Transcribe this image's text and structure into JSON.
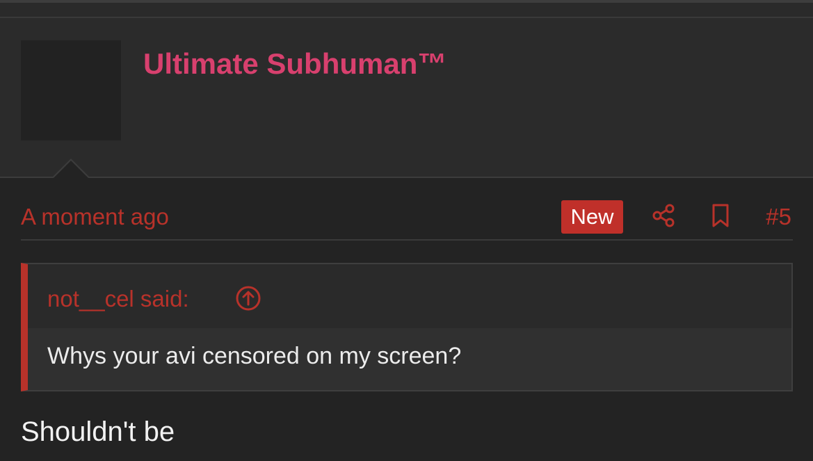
{
  "post": {
    "username": "Ultimate Subhuman™",
    "timestamp": "A moment ago",
    "new_badge": "New",
    "post_number": "#5",
    "quote": {
      "author": "not__cel said:",
      "text": "Whys your avi censored on my screen?"
    },
    "reply_text": "Shouldn't be"
  },
  "icons": {
    "share": "share-icon",
    "bookmark": "bookmark-icon",
    "quote_jump": "arrow-up-circle-icon"
  },
  "colors": {
    "username": "#d8406e",
    "accent": "#b8322a",
    "badge_bg": "#c0302a",
    "background": "#232323"
  }
}
